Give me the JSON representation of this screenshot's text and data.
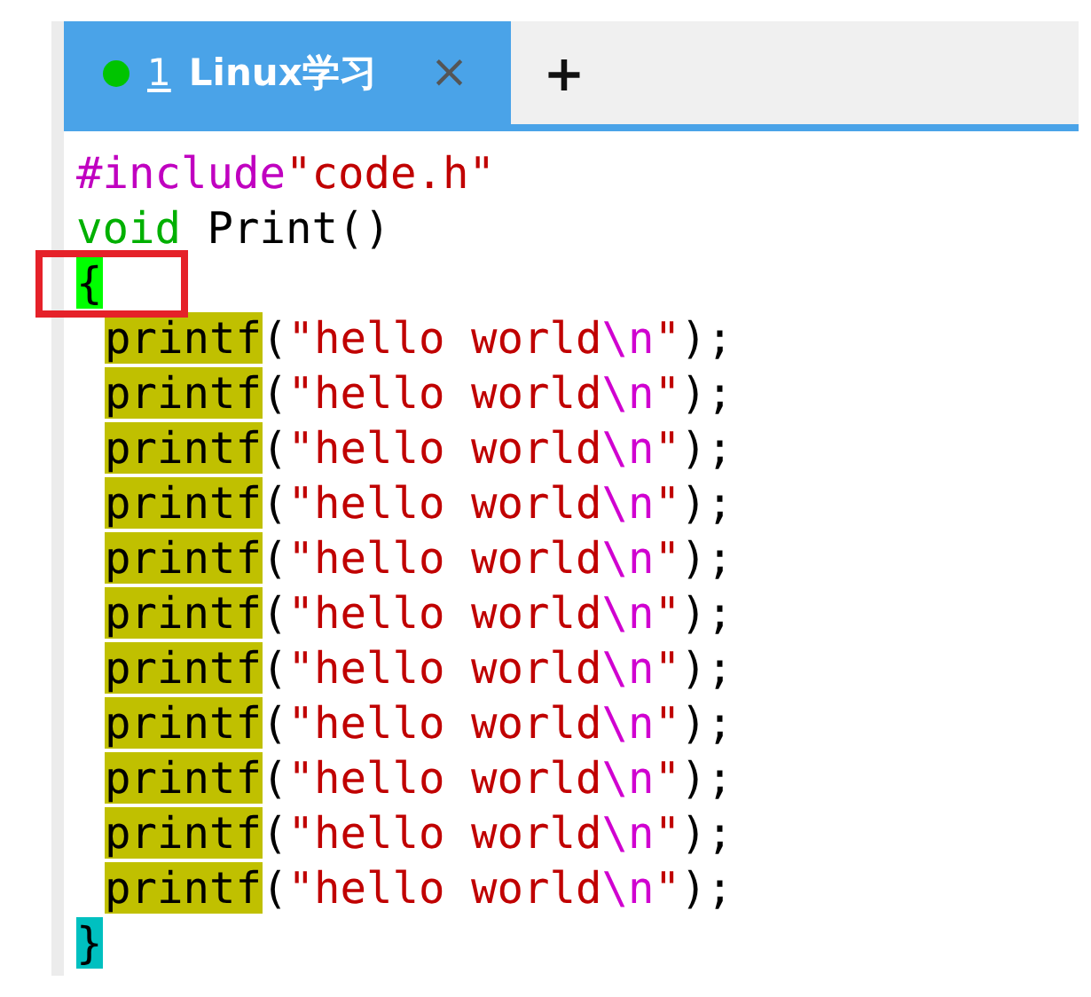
{
  "tabs": [
    {
      "color": "#00c400",
      "number": "1",
      "title": "Linux学习",
      "close": "×",
      "selected": true
    }
  ],
  "new_tab": "+",
  "code_lines": [
    {
      "indented": false,
      "tokens": [
        {
          "text": "#include",
          "kind": "preproc"
        },
        {
          "text": "\"code.h\"",
          "kind": "string"
        }
      ]
    },
    {
      "indented": false,
      "tokens": [
        {
          "text": "void",
          "kind": "keyword"
        },
        {
          "text": " Print()",
          "kind": "plain"
        }
      ]
    },
    {
      "indented": false,
      "tokens": [
        {
          "text": "{",
          "kind": "brace_match"
        }
      ]
    },
    {
      "indented": true,
      "tokens": [
        {
          "text": "printf",
          "kind": "call"
        },
        {
          "text": "(",
          "kind": "plain"
        },
        {
          "text": "\"hello world",
          "kind": "string"
        },
        {
          "text": "\\n",
          "kind": "escape"
        },
        {
          "text": "\"",
          "kind": "string"
        },
        {
          "text": ");",
          "kind": "plain"
        }
      ]
    },
    {
      "indented": true,
      "tokens": [
        {
          "text": "printf",
          "kind": "call"
        },
        {
          "text": "(",
          "kind": "plain"
        },
        {
          "text": "\"hello world",
          "kind": "string"
        },
        {
          "text": "\\n",
          "kind": "escape"
        },
        {
          "text": "\"",
          "kind": "string"
        },
        {
          "text": ");",
          "kind": "plain"
        }
      ]
    },
    {
      "indented": true,
      "tokens": [
        {
          "text": "printf",
          "kind": "call"
        },
        {
          "text": "(",
          "kind": "plain"
        },
        {
          "text": "\"hello world",
          "kind": "string"
        },
        {
          "text": "\\n",
          "kind": "escape"
        },
        {
          "text": "\"",
          "kind": "string"
        },
        {
          "text": ");",
          "kind": "plain"
        }
      ]
    },
    {
      "indented": true,
      "tokens": [
        {
          "text": "printf",
          "kind": "call"
        },
        {
          "text": "(",
          "kind": "plain"
        },
        {
          "text": "\"hello world",
          "kind": "string"
        },
        {
          "text": "\\n",
          "kind": "escape"
        },
        {
          "text": "\"",
          "kind": "string"
        },
        {
          "text": ");",
          "kind": "plain"
        }
      ]
    },
    {
      "indented": true,
      "tokens": [
        {
          "text": "printf",
          "kind": "call"
        },
        {
          "text": "(",
          "kind": "plain"
        },
        {
          "text": "\"hello world",
          "kind": "string"
        },
        {
          "text": "\\n",
          "kind": "escape"
        },
        {
          "text": "\"",
          "kind": "string"
        },
        {
          "text": ");",
          "kind": "plain"
        }
      ]
    },
    {
      "indented": true,
      "tokens": [
        {
          "text": "printf",
          "kind": "call"
        },
        {
          "text": "(",
          "kind": "plain"
        },
        {
          "text": "\"hello world",
          "kind": "string"
        },
        {
          "text": "\\n",
          "kind": "escape"
        },
        {
          "text": "\"",
          "kind": "string"
        },
        {
          "text": ");",
          "kind": "plain"
        }
      ]
    },
    {
      "indented": true,
      "tokens": [
        {
          "text": "printf",
          "kind": "call"
        },
        {
          "text": "(",
          "kind": "plain"
        },
        {
          "text": "\"hello world",
          "kind": "string"
        },
        {
          "text": "\\n",
          "kind": "escape"
        },
        {
          "text": "\"",
          "kind": "string"
        },
        {
          "text": ");",
          "kind": "plain"
        }
      ]
    },
    {
      "indented": true,
      "tokens": [
        {
          "text": "printf",
          "kind": "call"
        },
        {
          "text": "(",
          "kind": "plain"
        },
        {
          "text": "\"hello world",
          "kind": "string"
        },
        {
          "text": "\\n",
          "kind": "escape"
        },
        {
          "text": "\"",
          "kind": "string"
        },
        {
          "text": ");",
          "kind": "plain"
        }
      ]
    },
    {
      "indented": true,
      "tokens": [
        {
          "text": "printf",
          "kind": "call"
        },
        {
          "text": "(",
          "kind": "plain"
        },
        {
          "text": "\"hello world",
          "kind": "string"
        },
        {
          "text": "\\n",
          "kind": "escape"
        },
        {
          "text": "\"",
          "kind": "string"
        },
        {
          "text": ");",
          "kind": "plain"
        }
      ]
    },
    {
      "indented": true,
      "tokens": [
        {
          "text": "printf",
          "kind": "call"
        },
        {
          "text": "(",
          "kind": "plain"
        },
        {
          "text": "\"hello world",
          "kind": "string"
        },
        {
          "text": "\\n",
          "kind": "escape"
        },
        {
          "text": "\"",
          "kind": "string"
        },
        {
          "text": ");",
          "kind": "plain"
        }
      ]
    },
    {
      "indented": true,
      "tokens": [
        {
          "text": "printf",
          "kind": "call"
        },
        {
          "text": "(",
          "kind": "plain"
        },
        {
          "text": "\"hello world",
          "kind": "string"
        },
        {
          "text": "\\n",
          "kind": "escape"
        },
        {
          "text": "\"",
          "kind": "string"
        },
        {
          "text": ");",
          "kind": "plain"
        }
      ]
    },
    {
      "indented": false,
      "tokens": [
        {
          "text": "}",
          "kind": "brace_close"
        }
      ]
    }
  ]
}
